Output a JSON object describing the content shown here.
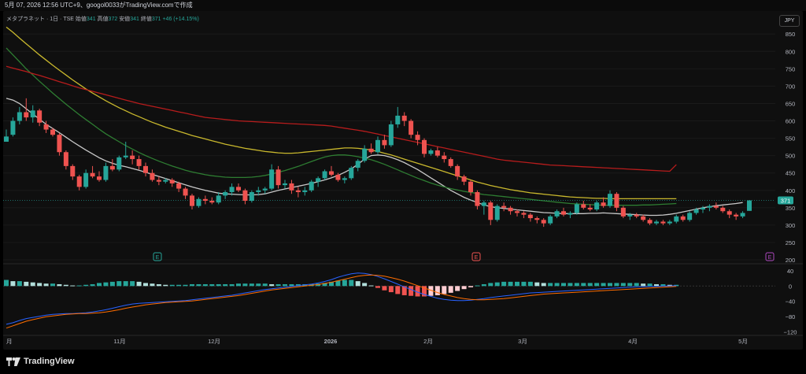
{
  "header": {
    "caption": "5月 07, 2026 12:56 UTC+9、googol0033がTradingView.comで作成"
  },
  "legend": {
    "symbol": "メタプラネット · 1日 · TSE",
    "open_label": "始値",
    "open": "341",
    "high_label": "高値",
    "high": "372",
    "low_label": "安値",
    "low": "341",
    "close_label": "終値",
    "close": "371",
    "change": "+46 (+14.15%)"
  },
  "currency": "JPY",
  "last_price_tag": "371",
  "brand": "TradingView",
  "colors": {
    "up": "#26a69a",
    "down": "#ef5350",
    "ma_white": "#c8c8c8",
    "ma_green": "#2e7d32",
    "ma_yellow": "#c9b82d",
    "ma_red": "#b71c1c",
    "macd": "#2962ff",
    "signal": "#ff6d00"
  },
  "chart_data": {
    "type": "candlestick",
    "price_axis": {
      "ticks": [
        "850",
        "800",
        "750",
        "700",
        "650",
        "600",
        "550",
        "500",
        "450",
        "400",
        "350",
        "300",
        "250",
        "200"
      ],
      "ylim": [
        200,
        880
      ]
    },
    "macd_axis": {
      "ticks": [
        "40",
        "0",
        "−40",
        "−80",
        "−120"
      ],
      "ylim": [
        -125,
        48
      ]
    },
    "time_axis": {
      "labels": [
        "月",
        "11月",
        "12月",
        "2026",
        "2月",
        "3月",
        "4月",
        "5月"
      ]
    },
    "candles": [
      [
        540,
        575,
        540,
        555
      ],
      [
        560,
        610,
        555,
        600
      ],
      [
        600,
        640,
        590,
        625
      ],
      [
        625,
        665,
        600,
        610
      ],
      [
        610,
        645,
        595,
        630
      ],
      [
        630,
        635,
        585,
        595
      ],
      [
        590,
        600,
        565,
        575
      ],
      [
        575,
        580,
        555,
        560
      ],
      [
        560,
        565,
        500,
        510
      ],
      [
        510,
        515,
        460,
        470
      ],
      [
        470,
        475,
        430,
        440
      ],
      [
        440,
        445,
        400,
        410
      ],
      [
        410,
        460,
        405,
        450
      ],
      [
        450,
        470,
        435,
        440
      ],
      [
        440,
        455,
        425,
        430
      ],
      [
        430,
        480,
        425,
        470
      ],
      [
        470,
        490,
        455,
        460
      ],
      [
        460,
        500,
        455,
        495
      ],
      [
        495,
        540,
        490,
        500
      ],
      [
        500,
        515,
        475,
        490
      ],
      [
        490,
        500,
        460,
        470
      ],
      [
        470,
        480,
        440,
        450
      ],
      [
        450,
        460,
        425,
        430
      ],
      [
        430,
        440,
        415,
        425
      ],
      [
        425,
        435,
        420,
        430
      ],
      [
        430,
        435,
        410,
        420
      ],
      [
        420,
        425,
        395,
        405
      ],
      [
        405,
        410,
        375,
        385
      ],
      [
        385,
        390,
        345,
        355
      ],
      [
        355,
        380,
        350,
        375
      ],
      [
        375,
        385,
        360,
        370
      ],
      [
        370,
        380,
        360,
        365
      ],
      [
        365,
        395,
        360,
        385
      ],
      [
        385,
        400,
        375,
        395
      ],
      [
        395,
        420,
        385,
        410
      ],
      [
        410,
        420,
        395,
        400
      ],
      [
        400,
        405,
        360,
        370
      ],
      [
        370,
        400,
        365,
        395
      ],
      [
        395,
        410,
        385,
        400
      ],
      [
        400,
        410,
        390,
        405
      ],
      [
        405,
        475,
        400,
        460
      ],
      [
        460,
        470,
        405,
        415
      ],
      [
        415,
        430,
        405,
        420
      ],
      [
        420,
        430,
        390,
        400
      ],
      [
        400,
        410,
        380,
        395
      ],
      [
        395,
        410,
        385,
        400
      ],
      [
        400,
        430,
        395,
        425
      ],
      [
        425,
        440,
        410,
        435
      ],
      [
        435,
        460,
        430,
        455
      ],
      [
        455,
        470,
        440,
        445
      ],
      [
        445,
        450,
        425,
        430
      ],
      [
        430,
        440,
        420,
        435
      ],
      [
        435,
        470,
        430,
        465
      ],
      [
        465,
        490,
        455,
        485
      ],
      [
        485,
        530,
        480,
        520
      ],
      [
        520,
        535,
        505,
        510
      ],
      [
        510,
        555,
        505,
        545
      ],
      [
        545,
        560,
        520,
        530
      ],
      [
        530,
        600,
        525,
        590
      ],
      [
        590,
        640,
        580,
        615
      ],
      [
        615,
        625,
        585,
        600
      ],
      [
        600,
        605,
        550,
        560
      ],
      [
        560,
        570,
        530,
        545
      ],
      [
        545,
        550,
        495,
        505
      ],
      [
        505,
        520,
        500,
        515
      ],
      [
        515,
        525,
        495,
        500
      ],
      [
        500,
        510,
        480,
        490
      ],
      [
        490,
        495,
        465,
        470
      ],
      [
        470,
        475,
        430,
        440
      ],
      [
        440,
        445,
        415,
        425
      ],
      [
        425,
        430,
        385,
        395
      ],
      [
        395,
        400,
        345,
        355
      ],
      [
        355,
        370,
        330,
        365
      ],
      [
        365,
        370,
        300,
        315
      ],
      [
        315,
        360,
        310,
        355
      ],
      [
        355,
        365,
        340,
        350
      ],
      [
        350,
        355,
        330,
        340
      ],
      [
        340,
        345,
        325,
        335
      ],
      [
        335,
        340,
        320,
        330
      ],
      [
        330,
        335,
        310,
        320
      ],
      [
        320,
        325,
        305,
        315
      ],
      [
        315,
        320,
        295,
        305
      ],
      [
        305,
        330,
        300,
        325
      ],
      [
        325,
        345,
        320,
        340
      ],
      [
        340,
        350,
        325,
        330
      ],
      [
        330,
        340,
        320,
        335
      ],
      [
        335,
        365,
        330,
        360
      ],
      [
        360,
        370,
        345,
        350
      ],
      [
        350,
        360,
        340,
        345
      ],
      [
        345,
        370,
        340,
        365
      ],
      [
        365,
        380,
        350,
        355
      ],
      [
        355,
        400,
        350,
        390
      ],
      [
        390,
        395,
        340,
        350
      ],
      [
        350,
        355,
        320,
        325
      ],
      [
        325,
        335,
        315,
        330
      ],
      [
        330,
        335,
        320,
        325
      ],
      [
        325,
        330,
        310,
        315
      ],
      [
        315,
        320,
        300,
        305
      ],
      [
        305,
        315,
        300,
        310
      ],
      [
        310,
        315,
        300,
        305
      ],
      [
        305,
        315,
        300,
        310
      ],
      [
        310,
        330,
        305,
        325
      ],
      [
        325,
        330,
        310,
        315
      ],
      [
        315,
        340,
        310,
        335
      ],
      [
        335,
        350,
        330,
        345
      ],
      [
        345,
        355,
        335,
        350
      ],
      [
        350,
        360,
        340,
        355
      ],
      [
        355,
        365,
        345,
        350
      ],
      [
        350,
        355,
        335,
        340
      ],
      [
        340,
        345,
        320,
        330
      ],
      [
        330,
        335,
        315,
        325
      ],
      [
        325,
        340,
        320,
        335
      ],
      [
        341,
        372,
        341,
        371
      ]
    ],
    "series": [
      {
        "name": "",
        "kind": "ma-white",
        "values": [
          665,
          660,
          650,
          635,
          620,
          605,
          590,
          578,
          566,
          553,
          540,
          528,
          516,
          505,
          494,
          485,
          478,
          472,
          468,
          463,
          458,
          452,
          446,
          440,
          434,
          428,
          422,
          416,
          410,
          405,
          400,
          396,
          392,
          390,
          389,
          388,
          387,
          387,
          388,
          390,
          395,
          400,
          404,
          408,
          412,
          416,
          420,
          425,
          430,
          436,
          443,
          452,
          462,
          475,
          490,
          500,
          502,
          500,
          495,
          488,
          480,
          470,
          460,
          448,
          436,
          424,
          412,
          400,
          390,
          380,
          372,
          365,
          358,
          353,
          350,
          348,
          346,
          344,
          342,
          340,
          338,
          336,
          335,
          334,
          333,
          333,
          333,
          333,
          334,
          334,
          335,
          334,
          333,
          332,
          331,
          330,
          329,
          328,
          328,
          329,
          331,
          334,
          338,
          342,
          346,
          350,
          353,
          356,
          358,
          360,
          362,
          365
        ]
      },
      {
        "name": "",
        "kind": "ma-green",
        "values": [
          810,
          790,
          770,
          750,
          732,
          714,
          697,
          680,
          664,
          648,
          633,
          618,
          604,
          590,
          576,
          563,
          551,
          540,
          529,
          519,
          509,
          500,
          492,
          484,
          477,
          470,
          464,
          458,
          453,
          449,
          445,
          442,
          440,
          438,
          437,
          437,
          437,
          438,
          440,
          443,
          447,
          452,
          457,
          463,
          469,
          476,
          483,
          490,
          496,
          500,
          502,
          502,
          500,
          497,
          493,
          488,
          482,
          475,
          467,
          459,
          451,
          443,
          435,
          428,
          421,
          415,
          410,
          405,
          401,
          397,
          394,
          391,
          388,
          386,
          384,
          382,
          380,
          378,
          376,
          374,
          372,
          370,
          368,
          366,
          364,
          362,
          361,
          360,
          359,
          358,
          357,
          357,
          357,
          357,
          357,
          357,
          358,
          358,
          359,
          360,
          361,
          362
        ]
      },
      {
        "name": "",
        "kind": "ma-yellow",
        "values": [
          870,
          855,
          838,
          822,
          806,
          790,
          775,
          760,
          746,
          732,
          718,
          705,
          692,
          680,
          669,
          658,
          648,
          638,
          629,
          620,
          612,
          604,
          596,
          589,
          582,
          576,
          570,
          564,
          558,
          553,
          548,
          543,
          538,
          533,
          529,
          525,
          521,
          518,
          515,
          512,
          510,
          508,
          507,
          507,
          508,
          510,
          512,
          514,
          516,
          518,
          520,
          522,
          522,
          521,
          519,
          516,
          512,
          507,
          502,
          496,
          490,
          484,
          478,
          472,
          466,
          460,
          454,
          448,
          442,
          436,
          430,
          424,
          419,
          414,
          410,
          406,
          402,
          399,
          396,
          393,
          391,
          389,
          387,
          385,
          383,
          381,
          380,
          379,
          378,
          377,
          377,
          376,
          376,
          376,
          376,
          376,
          376,
          376,
          376,
          376,
          376,
          376
        ]
      },
      {
        "name": "",
        "kind": "ma-red",
        "values": [
          757,
          752,
          747,
          742,
          736,
          731,
          725,
          719,
          713,
          707,
          701,
          695,
          690,
          685,
          680,
          675,
          670,
          665,
          660,
          655,
          650,
          646,
          642,
          638,
          634,
          630,
          626,
          622,
          618,
          614,
          610,
          608,
          606,
          604,
          602,
          600,
          599,
          598,
          597,
          596,
          595,
          594,
          593,
          592,
          591,
          590,
          589,
          588,
          587,
          585,
          582,
          579,
          576,
          573,
          570,
          566,
          562,
          558,
          554,
          550,
          546,
          542,
          538,
          534,
          530,
          526,
          522,
          518,
          514,
          510,
          506,
          502,
          498,
          494,
          490,
          487,
          485,
          483,
          481,
          479,
          477,
          475,
          473,
          472,
          471,
          470,
          469,
          468,
          467,
          466,
          465,
          464,
          463,
          462,
          461,
          460,
          459,
          458,
          457,
          456,
          455,
          474
        ]
      },
      {
        "name": "",
        "kind": "macd",
        "values": [
          -100,
          -96,
          -90,
          -85,
          -82,
          -79,
          -76,
          -74,
          -73,
          -72,
          -72,
          -71,
          -70,
          -68,
          -65,
          -62,
          -58,
          -54,
          -50,
          -47,
          -45,
          -44,
          -43,
          -42,
          -41,
          -40,
          -39,
          -38,
          -36,
          -34,
          -32,
          -30,
          -28,
          -26,
          -24,
          -21,
          -18,
          -15,
          -12,
          -9,
          -7,
          -5,
          -3,
          -1,
          1,
          3,
          5,
          8,
          12,
          17,
          23,
          28,
          32,
          34,
          33,
          30,
          25,
          19,
          12,
          5,
          -2,
          -9,
          -16,
          -22,
          -27,
          -32,
          -35,
          -37,
          -38,
          -38,
          -37,
          -35,
          -33,
          -30,
          -28,
          -26,
          -24,
          -22,
          -20,
          -18,
          -17,
          -16,
          -15,
          -14,
          -13,
          -12,
          -11,
          -10,
          -9,
          -8,
          -7,
          -6,
          -5,
          -4,
          -3,
          -2,
          -2,
          -1,
          -1,
          0,
          0,
          1
        ]
      },
      {
        "name": "",
        "kind": "signal",
        "values": [
          -110,
          -104,
          -98,
          -92,
          -88,
          -84,
          -80,
          -78,
          -76,
          -74,
          -73,
          -72,
          -72,
          -71,
          -70,
          -68,
          -65,
          -62,
          -58,
          -55,
          -52,
          -49,
          -47,
          -45,
          -43,
          -42,
          -41,
          -40,
          -39,
          -37,
          -35,
          -33,
          -31,
          -29,
          -27,
          -25,
          -22,
          -19,
          -16,
          -13,
          -10,
          -8,
          -6,
          -4,
          -2,
          0,
          2,
          4,
          7,
          10,
          14,
          18,
          22,
          26,
          28,
          29,
          28,
          26,
          22,
          18,
          13,
          7,
          1,
          -5,
          -11,
          -17,
          -22,
          -26,
          -30,
          -33,
          -35,
          -36,
          -36,
          -35,
          -34,
          -33,
          -31,
          -29,
          -27,
          -25,
          -23,
          -21,
          -20,
          -19,
          -18,
          -17,
          -16,
          -15,
          -14,
          -13,
          -12,
          -11,
          -10,
          -9,
          -8,
          -7,
          -6,
          -5,
          -4,
          -3,
          -2,
          -1
        ]
      }
    ]
  }
}
